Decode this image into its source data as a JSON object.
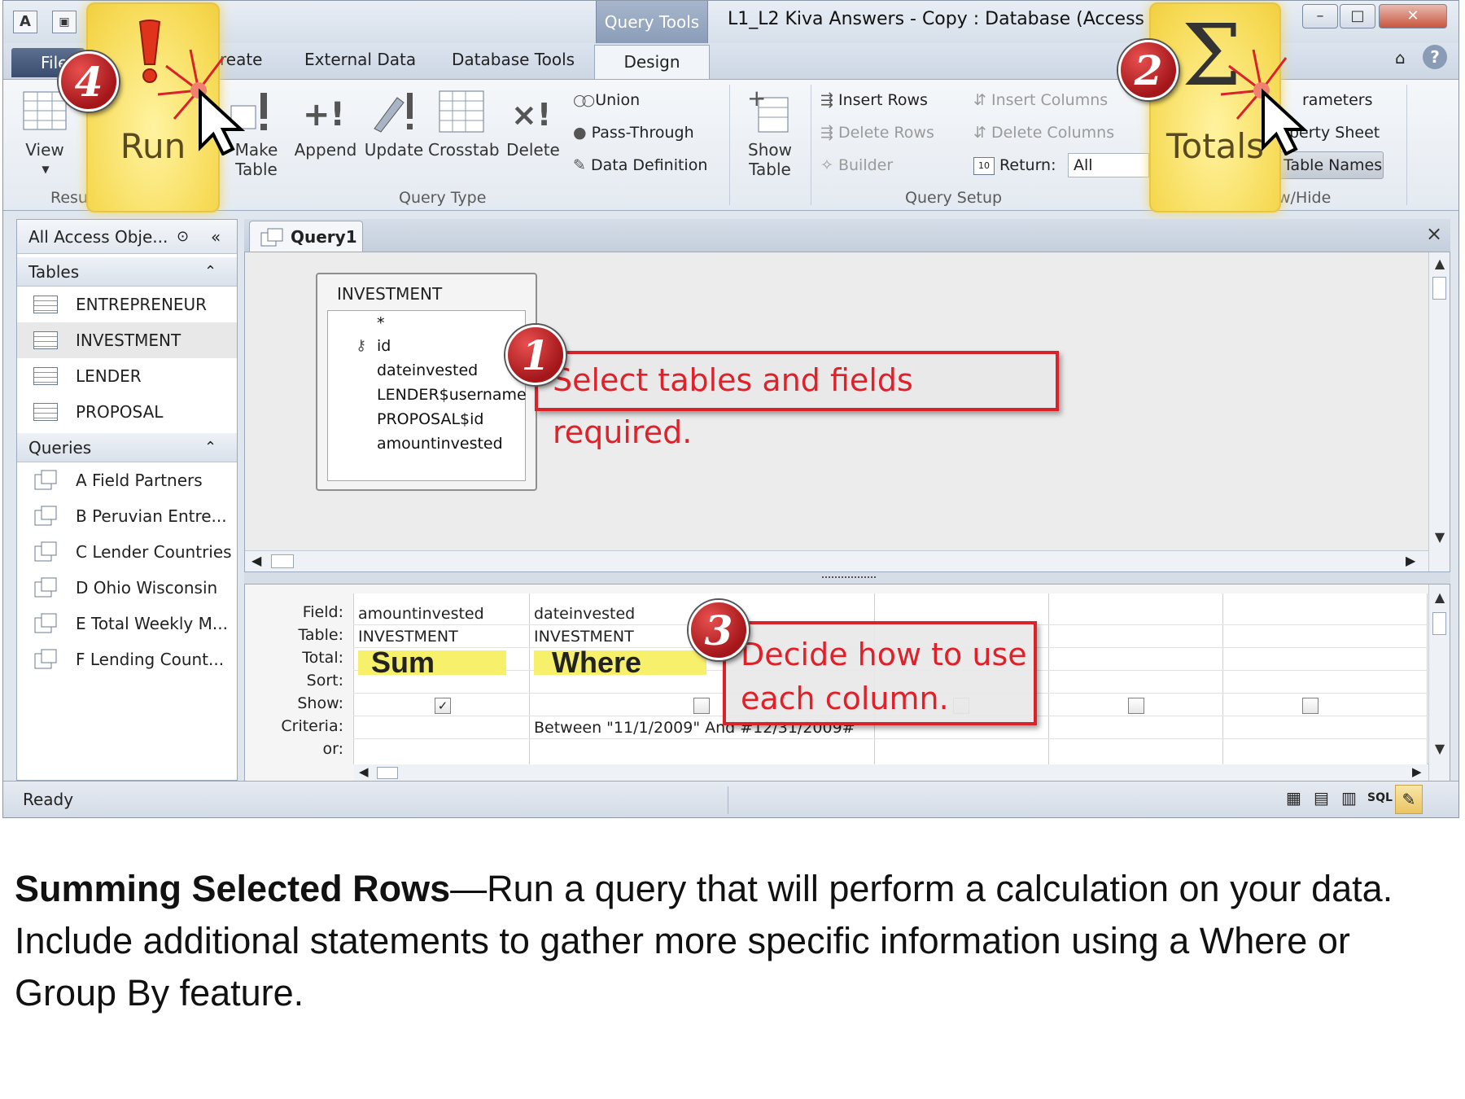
{
  "window": {
    "title": "L1_L2 Kiva Answers - Copy : Database (Access 2007)",
    "context_tab": "Query Tools",
    "help": "?"
  },
  "quick_access": {
    "access_icon": "A"
  },
  "tabs": {
    "file": "File",
    "create": "reate",
    "external_data": "External Data",
    "database_tools": "Database Tools",
    "design": "Design"
  },
  "ribbon": {
    "view": "View",
    "run": "Run",
    "results_group": "Resu",
    "make_table": [
      "Make",
      "Table"
    ],
    "append": "Append",
    "update": "Update",
    "crosstab": "Crosstab",
    "delete": "Delete",
    "union": "Union",
    "pass_through": "Pass-Through",
    "data_definition": "Data Definition",
    "query_type_group": "Query Type",
    "show_table": [
      "Show",
      "Table"
    ],
    "insert_rows": "Insert Rows",
    "delete_rows": "Delete Rows",
    "builder": "Builder",
    "insert_columns": "Insert Columns",
    "delete_columns": "Delete Columns",
    "return_label": "Return:",
    "return_value": "All",
    "query_setup_group": "Query Setup",
    "totals": "Totals",
    "parameters": "rameters",
    "property_sheet": "perty Sheet",
    "table_names": "Table Names",
    "show_hide_group": "w/Hide"
  },
  "nav": {
    "header": "All Access Obje...",
    "tables_header": "Tables",
    "tables": [
      "ENTREPRENEUR",
      "INVESTMENT",
      "LENDER",
      "PROPOSAL"
    ],
    "queries_header": "Queries",
    "queries": [
      "A Field Partners",
      "B Peruvian Entre...",
      "C Lender Countries",
      "D Ohio Wisconsin",
      "E Total Weekly M...",
      "F Lending Count..."
    ]
  },
  "document": {
    "tab": "Query1",
    "close": "×"
  },
  "field_list": {
    "title": "INVESTMENT",
    "fields": [
      "*",
      "id",
      "dateinvested",
      "LENDER$username",
      "PROPOSAL$id",
      "amountinvested"
    ]
  },
  "grid": {
    "row_labels": [
      "Field:",
      "Table:",
      "Total:",
      "Sort:",
      "Show:",
      "Criteria:",
      "or:"
    ],
    "col1": {
      "field": "amountinvested",
      "table": "INVESTMENT",
      "total": "Sum",
      "show": "✓"
    },
    "col2": {
      "field": "dateinvested",
      "table": "INVESTMENT",
      "total": "Where",
      "criteria": "Between \"11/1/2009\" And #12/31/2009#"
    }
  },
  "status": {
    "text": "Ready",
    "sql": "SQL"
  },
  "annotations": {
    "step1": {
      "number": "1",
      "text": "Select tables and fields required."
    },
    "step2": {
      "number": "2"
    },
    "step3": {
      "number": "3",
      "line1": "Decide how to use",
      "line2": "each column."
    },
    "step4": {
      "number": "4"
    }
  },
  "caption": {
    "bold": "Summing Selected Rows",
    "dash": "—",
    "text": "Run a query that will perform a calculation on your data.  Include additional statements to gather more specific information using a Where or Group By feature."
  },
  "colors": {
    "highlight": "#f7dc5a",
    "callout_red": "#d8232a",
    "grid_yellow": "#f6f06a"
  }
}
